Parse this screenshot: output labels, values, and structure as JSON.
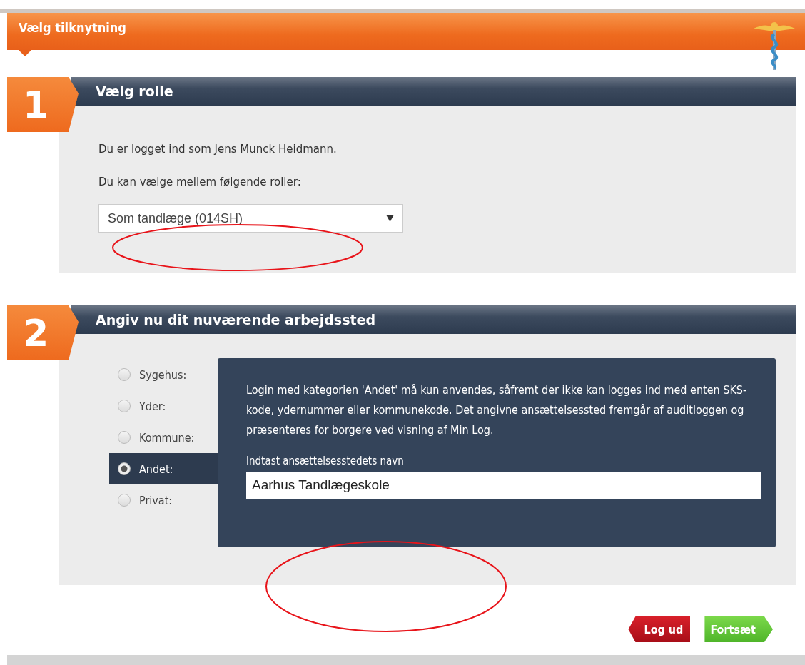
{
  "header": {
    "title": "Vælg tilknytning"
  },
  "role_section": {
    "number": "1",
    "title": "Vælg rolle",
    "logged_in_text": "Du er logget ind som Jens Munck Heidmann.",
    "choose_text": "Du kan vælge mellem følgende roller:",
    "role_select": {
      "value": "Som tandlæge (014SH)"
    }
  },
  "workplace_section": {
    "number": "2",
    "title": "Angiv nu dit nuværende arbejdssted",
    "options": [
      {
        "label": "Sygehus:",
        "selected": false
      },
      {
        "label": "Yder:",
        "selected": false
      },
      {
        "label": "Kommune:",
        "selected": false
      },
      {
        "label": "Andet:",
        "selected": true
      },
      {
        "label": "Privat:",
        "selected": false
      }
    ],
    "detail": {
      "notice": "Login med kategorien 'Andet' må kun anvendes, såfremt der ikke kan logges ind med enten SKS-kode, ydernummer eller kommunekode. Det angivne ansættelsessted fremgår af auditloggen og præsenteres for borgere ved visning af Min Log.",
      "field_label": "Indtast ansættelsesstedets navn",
      "field_value": "Aarhus Tandlægeskole"
    }
  },
  "buttons": [
    {
      "label": "Log ud",
      "kind": "back"
    },
    {
      "label": "Fortsæt",
      "kind": "forward"
    }
  ]
}
